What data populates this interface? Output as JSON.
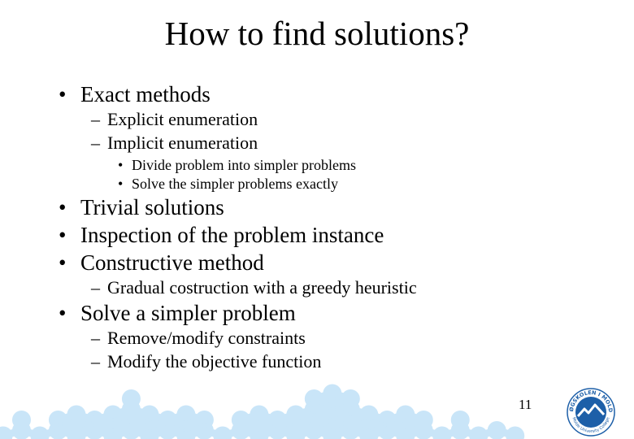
{
  "slide": {
    "title": "How to find solutions?",
    "page_number": "11",
    "bullets": {
      "b1": {
        "marker": "•",
        "text": "Exact methods"
      },
      "b1_1": {
        "marker": "–",
        "text": "Explicit enumeration"
      },
      "b1_2": {
        "marker": "–",
        "text": "Implicit enumeration"
      },
      "b1_2_1": {
        "marker": "•",
        "text": "Divide problem into simpler problems"
      },
      "b1_2_2": {
        "marker": "•",
        "text": "Solve the simpler problems exactly"
      },
      "b2": {
        "marker": "•",
        "text": "Trivial solutions"
      },
      "b3": {
        "marker": "•",
        "text": "Inspection of the problem instance"
      },
      "b4": {
        "marker": "•",
        "text": "Constructive method"
      },
      "b4_1": {
        "marker": "–",
        "text": "Gradual costruction with a greedy heuristic"
      },
      "b5": {
        "marker": "•",
        "text": "Solve a simpler problem"
      },
      "b5_1": {
        "marker": "–",
        "text": "Remove/modify constraints"
      },
      "b5_2": {
        "marker": "–",
        "text": "Modify the objective function"
      }
    }
  },
  "logo": {
    "top_text": "HØGSKOLEN I MOLDE",
    "bottom_text": "Molde University College"
  },
  "colors": {
    "pattern": "#c9e5f8",
    "logo_blue": "#1d5fa8"
  }
}
